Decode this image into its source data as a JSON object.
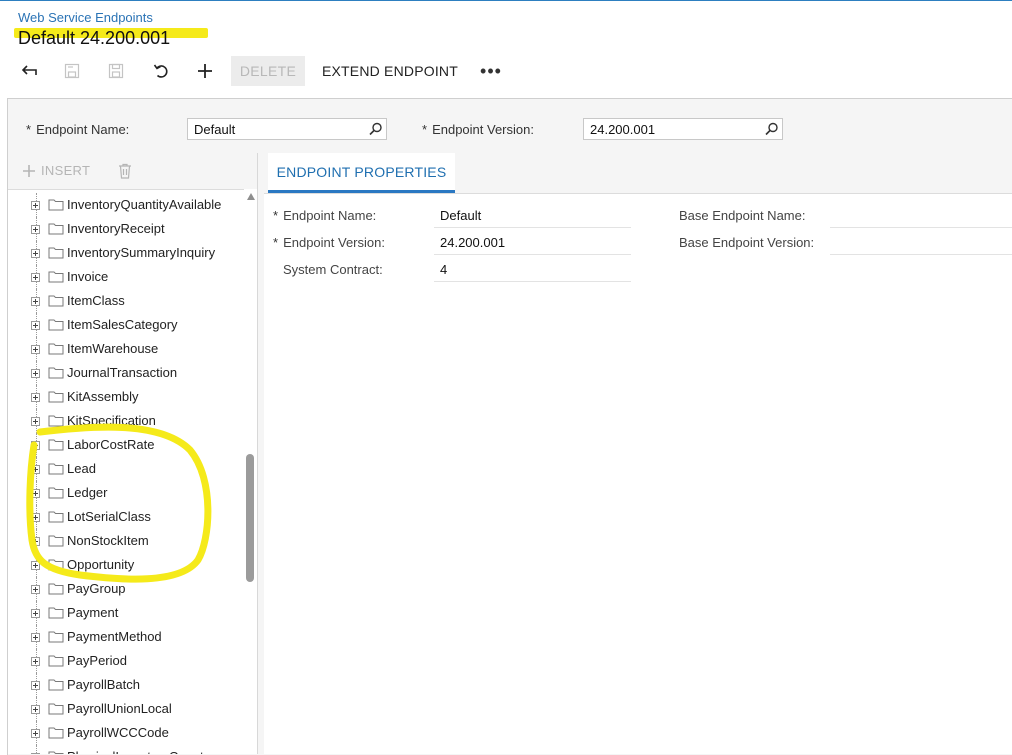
{
  "header": {
    "breadcrumb": "Web Service Endpoints",
    "title": "Default 24.200.001"
  },
  "toolbar": {
    "back_icon": "back-arrow-icon",
    "save_close_icon": "save-close-icon",
    "save_icon": "save-icon",
    "cancel_icon": "undo-icon",
    "add_icon": "plus-icon",
    "delete_label": "DELETE",
    "extend_label": "EXTEND ENDPOINT",
    "more_label": "•••"
  },
  "summary": {
    "endpoint_name_label": "Endpoint Name:",
    "endpoint_name_value": "Default",
    "endpoint_version_label": "Endpoint Version:",
    "endpoint_version_value": "24.200.001",
    "required_mark": "*"
  },
  "tree": {
    "insert_label": "INSERT",
    "items": [
      "InventoryQuantityAvailable",
      "InventoryReceipt",
      "InventorySummaryInquiry",
      "Invoice",
      "ItemClass",
      "ItemSalesCategory",
      "ItemWarehouse",
      "JournalTransaction",
      "KitAssembly",
      "KitSpecification",
      "LaborCostRate",
      "Lead",
      "Ledger",
      "LotSerialClass",
      "NonStockItem",
      "Opportunity",
      "PayGroup",
      "Payment",
      "PaymentMethod",
      "PayPeriod",
      "PayrollBatch",
      "PayrollUnionLocal",
      "PayrollWCCCode",
      "PhysicalInventoryCount"
    ]
  },
  "tabs": [
    {
      "label": "ENDPOINT PROPERTIES"
    }
  ],
  "properties": {
    "endpoint_name_label": "Endpoint Name:",
    "endpoint_name_value": "Default",
    "endpoint_version_label": "Endpoint Version:",
    "endpoint_version_value": "24.200.001",
    "system_contract_label": "System Contract:",
    "system_contract_value": "4",
    "base_endpoint_name_label": "Base Endpoint Name:",
    "base_endpoint_name_value": "",
    "base_endpoint_version_label": "Base Endpoint Version:",
    "base_endpoint_version_value": ""
  },
  "colors": {
    "accent": "#2a78c2",
    "highlight": "#f5ea1a"
  }
}
